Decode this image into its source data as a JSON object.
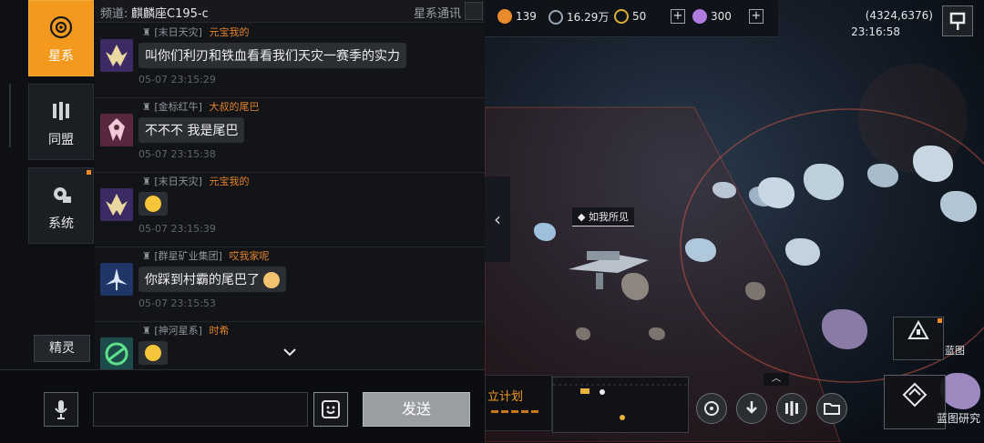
{
  "chat": {
    "tabs": [
      {
        "label": "星系",
        "active": true,
        "icon": "galaxy-icon"
      },
      {
        "label": "同盟",
        "active": false,
        "icon": "alliance-icon"
      },
      {
        "label": "系统",
        "active": false,
        "icon": "system-gear-icon"
      }
    ],
    "sprite_button": "精灵",
    "header": {
      "channel_label": "频道:",
      "channel_name": "麒麟座C195-c",
      "title": "星系通讯"
    },
    "messages": [
      {
        "rank_icon": "rank-icon",
        "guild": "[末日天灾]",
        "name": "元宝我的",
        "text": "叫你们利刃和铁血看看我们天灾一赛季的实力",
        "time": "05-07 23:15:29"
      },
      {
        "rank_icon": "rank-icon",
        "guild": "[金标红牛]",
        "name": "大叔的尾巴",
        "text": "不不不 我是尾巴",
        "time": "05-07 23:15:38"
      },
      {
        "rank_icon": "rank-icon",
        "guild": "[末日天灾]",
        "name": "元宝我的",
        "text": "",
        "emoji": "grin-emoji",
        "time": "05-07 23:15:39"
      },
      {
        "rank_icon": "rank-icon",
        "guild": "[群星矿业集团]",
        "name": "哎我家呢",
        "text": "你踩到村霸的尾巴了",
        "emoji": "cat-emoji",
        "time": "05-07 23:15:53"
      },
      {
        "rank_icon": "rank-icon",
        "guild": "[神河星系]",
        "name": "时希",
        "text": "",
        "emoji": "thinking-emoji",
        "time": ""
      }
    ],
    "input": {
      "value": "",
      "placeholder": ""
    },
    "send_label": "发送"
  },
  "map": {
    "resources": [
      {
        "icon": "alloy-icon",
        "value": "139",
        "color": "#e98b2c"
      },
      {
        "icon": "credits-icon",
        "value": "16.29万",
        "color": "#9aa6b6"
      },
      {
        "icon": "gold-icon",
        "value": "50",
        "color": "#d8b232"
      },
      {
        "icon": "premium-icon",
        "value": "300",
        "color": "#b07adf"
      }
    ],
    "coords": "(4324,6376)",
    "time": "23:16:58",
    "target_label": "如我所见",
    "plan_label": "立计划",
    "blueprint_label": "蓝图",
    "research_label": "蓝图研究",
    "bottom_buttons": [
      "galaxy-swirl-icon",
      "download-icon",
      "alliance-icon",
      "folder-icon"
    ]
  }
}
